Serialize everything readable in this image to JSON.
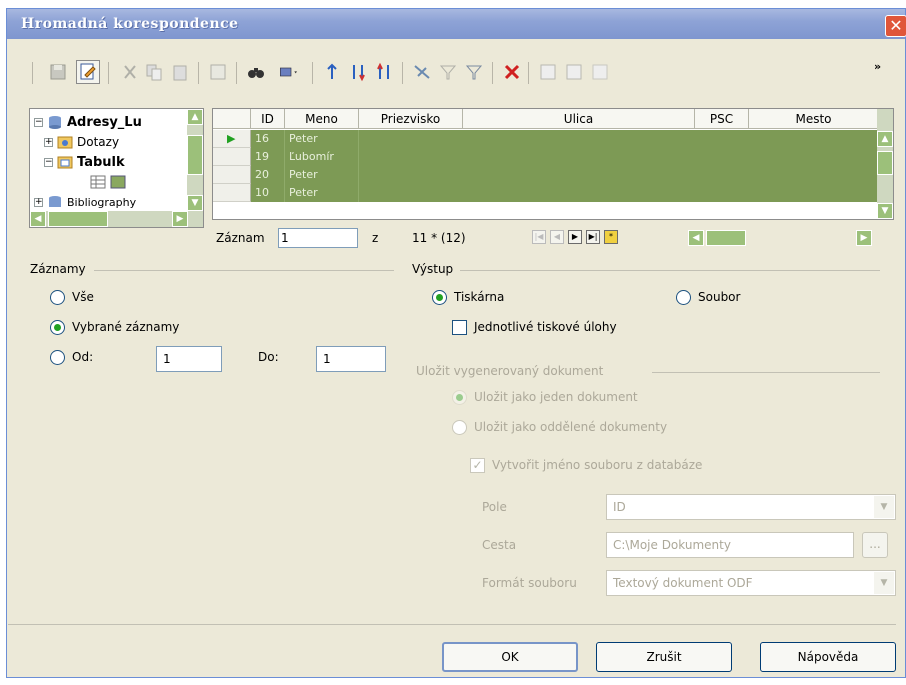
{
  "window": {
    "title": "Hromadná korespondence",
    "close": "✕"
  },
  "toolbar": {
    "overflow": "»"
  },
  "tree": {
    "items": [
      {
        "label": "Adresy_Lu",
        "icon": "database-icon"
      },
      {
        "label": "Dotazy",
        "icon": "queries-folder-icon"
      },
      {
        "label": "Tabulk",
        "icon": "tables-folder-icon"
      },
      {
        "label": "",
        "icon": "table-icon"
      },
      {
        "label": "Bibliography",
        "icon": "database-icon"
      }
    ]
  },
  "grid": {
    "columns": [
      "ID",
      "Meno",
      "Priezvisko",
      "Ulica",
      "PSC",
      "Mesto"
    ],
    "rows": [
      {
        "id": "16",
        "meno": "Peter",
        "rest": ""
      },
      {
        "id": "19",
        "meno": "Ľubomír",
        "rest": ""
      },
      {
        "id": "20",
        "meno": "Peter",
        "rest": ""
      },
      {
        "id": "10",
        "meno": "Peter",
        "rest": ""
      }
    ],
    "nav": {
      "label": "Záznam",
      "value": "1",
      "of": "z",
      "count": "11 * (12)"
    }
  },
  "zaznamy": {
    "title": "Záznamy",
    "all": "Vše",
    "selected": "Vybrané záznamy",
    "from_label": "Od:",
    "from_value": "1",
    "to_label": "Do:",
    "to_value": "1"
  },
  "vystup": {
    "title": "Výstup",
    "printer": "Tiskárna",
    "file": "Soubor",
    "single_jobs": "Jednotlivé tiskové úlohy",
    "save_title": "Uložit vygenerovaný dokument",
    "save_single": "Uložit jako jeden dokument",
    "save_separate": "Uložit jako oddělené dokumenty",
    "gen_name": "Vytvořit jméno souboru z databáze",
    "field_label": "Pole",
    "field_value": "ID",
    "path_label": "Cesta",
    "path_value": "C:\\Moje Dokumenty",
    "format_label": "Formát souboru",
    "format_value": "Textový dokument ODF",
    "browse": "..."
  },
  "buttons": {
    "ok": "OK",
    "cancel": "Zrušit",
    "help": "Nápověda"
  }
}
